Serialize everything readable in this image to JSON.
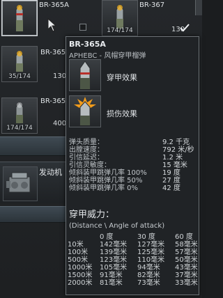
{
  "slots": {
    "slot1": {
      "name": "BR-365A"
    },
    "slot2": {
      "name": "BR-367",
      "count": "174/174",
      "side_count": "130"
    },
    "slot3": {
      "name": "BR-365",
      "count": "35/174",
      "side_count": "130"
    },
    "slot4": {
      "name": "BR-365",
      "count": "174/174",
      "side_count": "400"
    }
  },
  "engine": {
    "label": "发动机"
  },
  "tooltip": {
    "title": "BR-365A",
    "subtitle": "APHEBC - 风帽穿甲榴弹",
    "effects": [
      {
        "label": "穿甲效果"
      },
      {
        "label": "损伤效果"
      }
    ],
    "stats": [
      {
        "label": "弹头质量：",
        "value": "9.2 千克"
      },
      {
        "label": "出膛速度：",
        "value": "792 米/秒"
      },
      {
        "label": "引信延迟：",
        "value": "1.2 米"
      },
      {
        "label": "引信灵敏度：",
        "value": "15 毫米"
      },
      {
        "label": "倾斜装甲跳弹几率 100%",
        "value": "19 度"
      },
      {
        "label": "倾斜装甲跳弹几率 50%",
        "value": "27 度"
      },
      {
        "label": "倾斜装甲跳弹几率 0%",
        "value": "42 度"
      }
    ],
    "penetration_title": "穿甲威力：",
    "penetration_subtitle": "(Distance \\ Angle of attack)",
    "pen_headers": [
      "",
      "0 度",
      "30 度",
      "60 度"
    ],
    "pen_rows": [
      [
        "10米",
        "142毫米",
        "127毫米",
        "58毫米"
      ],
      [
        "100米",
        "139毫米",
        "125毫米",
        "57毫米"
      ],
      [
        "500米",
        "123毫米",
        "110毫米",
        "50毫米"
      ],
      [
        "1000米",
        "105毫米",
        "94毫米",
        "43毫米"
      ],
      [
        "1500米",
        "91毫米",
        "82毫米",
        "37毫米"
      ],
      [
        "2000米",
        "81毫米",
        "73毫米",
        "33毫米"
      ]
    ]
  }
}
